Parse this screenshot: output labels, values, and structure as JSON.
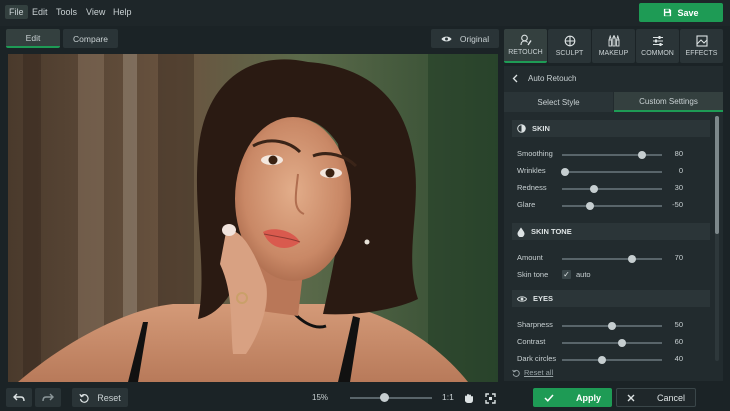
{
  "menu": [
    "File",
    "Edit",
    "Tools",
    "View",
    "Help"
  ],
  "save_label": "Save",
  "view_tabs": {
    "edit": "Edit",
    "compare": "Compare"
  },
  "original_label": "Original",
  "tool_tabs": [
    "RETOUCH",
    "SCULPT",
    "MAKEUP",
    "COMMON",
    "EFFECTS"
  ],
  "panel": {
    "title": "Auto Retouch",
    "subtabs": [
      "Select Style",
      "Custom Settings"
    ],
    "skin": {
      "title": "SKIN",
      "rows": [
        {
          "label": "Smoothing",
          "value": "80",
          "level": 0.8
        },
        {
          "label": "Wrinkles",
          "value": "0",
          "level": 0.03
        },
        {
          "label": "Redness",
          "value": "30",
          "level": 0.32
        },
        {
          "label": "Glare",
          "value": "-50",
          "level": 0.28
        }
      ]
    },
    "skin_tone": {
      "title": "SKIN TONE",
      "amount_label": "Amount",
      "amount_value": "70",
      "amount_level": 0.7,
      "tone_label": "Skin tone",
      "tone_check": "auto"
    },
    "eyes": {
      "title": "EYES",
      "rows": [
        {
          "label": "Sharpness",
          "value": "50",
          "level": 0.5
        },
        {
          "label": "Contrast",
          "value": "60",
          "level": 0.6
        },
        {
          "label": "Dark circles",
          "value": "40",
          "level": 0.4
        }
      ]
    },
    "reset_all": "Reset all"
  },
  "bottom": {
    "reset_label": "Reset",
    "zoom_percent": "15%",
    "zoom_level": 0.42,
    "zoom_1to1": "1:1",
    "apply_label": "Apply",
    "cancel_label": "Cancel"
  },
  "colors": {
    "accent": "#1e9b55",
    "background": "#1b2326",
    "panel": "#222b2e"
  }
}
